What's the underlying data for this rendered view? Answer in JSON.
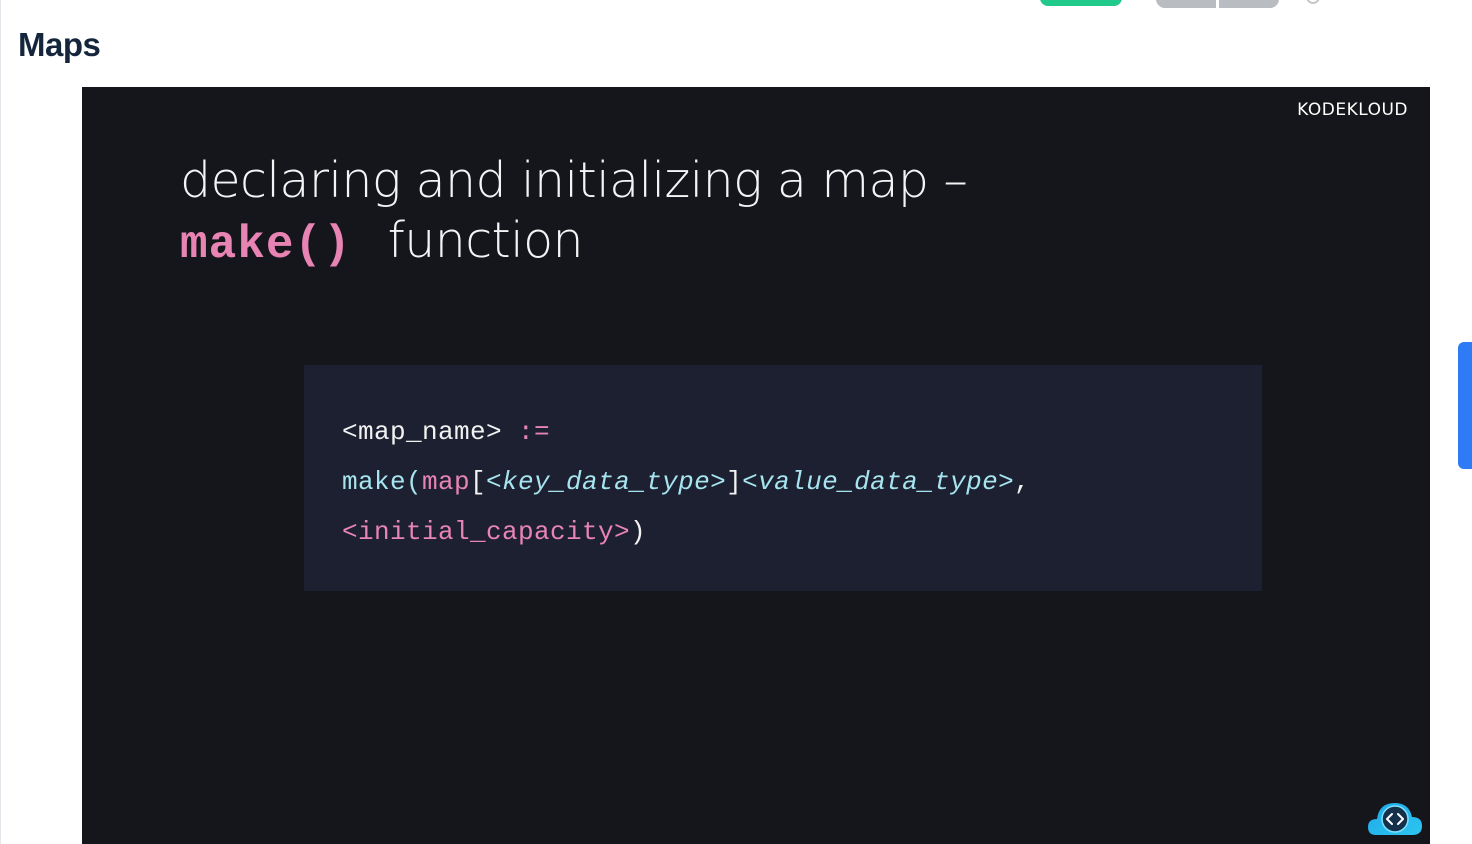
{
  "page": {
    "title": "Maps"
  },
  "slide": {
    "brand": "KODEKLOUD",
    "heading_line1": "declaring and initializing a map –",
    "heading_code": "make()",
    "heading_word": "function"
  },
  "code": {
    "line1_name": "<map_name>",
    "line1_op": ":=",
    "line2_make": "make(",
    "line2_map": "map",
    "line2_lbr": "[",
    "line2_key": "<key_data_type>",
    "line2_rbr": "]",
    "line2_value": "<value_data_type>",
    "line2_comma": ",",
    "line3_cap": "<initial_capacity>",
    "line3_close": ")"
  },
  "icons": {
    "assistant": "cloud-code-icon",
    "help": "help-icon"
  },
  "colors": {
    "accent_green": "#21c98a",
    "accent_blue": "#2f7bf5",
    "code_pink": "#e884b4",
    "code_cyan": "#a6e4ef",
    "slide_bg": "#15161b"
  }
}
